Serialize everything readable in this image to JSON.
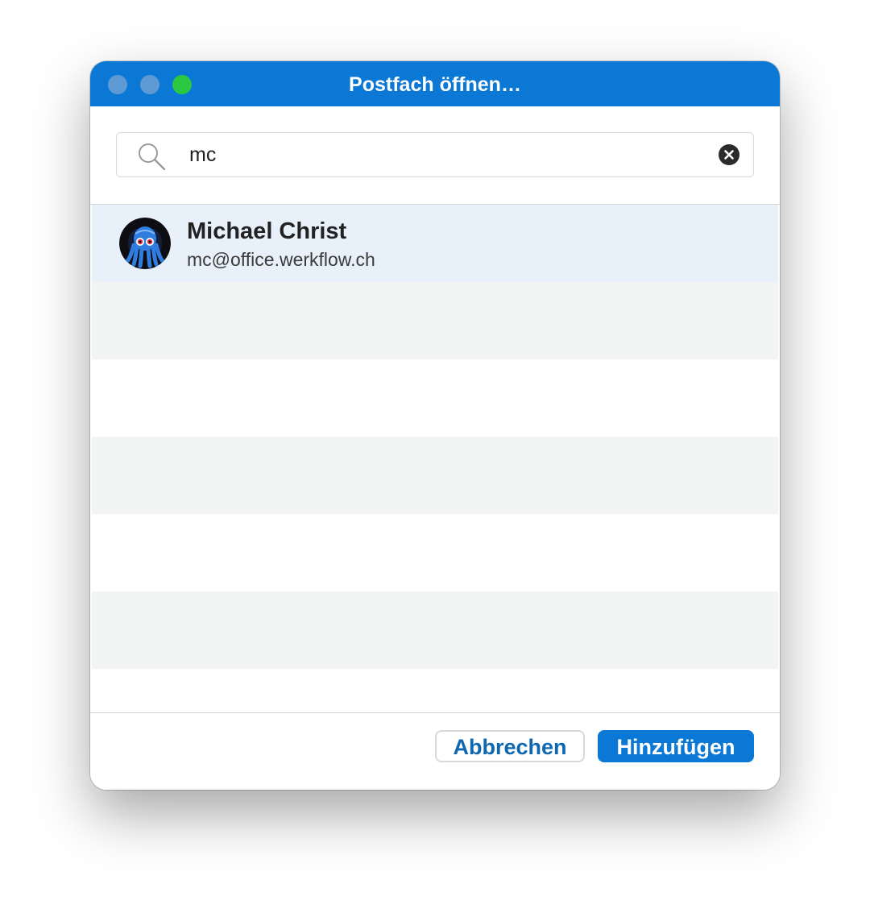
{
  "window": {
    "title": "Postfach öffnen…"
  },
  "search": {
    "value": "mc",
    "icon": "magnifier",
    "clear_icon": "x-circle"
  },
  "results": [
    {
      "name": "Michael Christ",
      "email": "mc@office.werkflow.ch",
      "selected": true,
      "avatar": "blue-octopus-avatar"
    }
  ],
  "buttons": {
    "cancel_label": "Abbrechen",
    "add_label": "Hinzufügen"
  },
  "colors": {
    "accent": "#0a78d4",
    "selected_row": "#e8f1fa",
    "striped_row": "#f2f4f4"
  }
}
